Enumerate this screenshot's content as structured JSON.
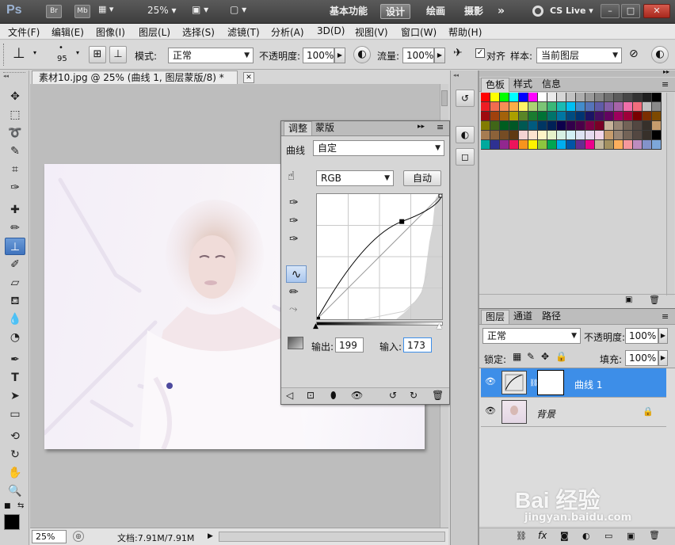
{
  "app": {
    "logo": "Ps",
    "bridge": "Br",
    "minibridge": "Mb",
    "zoom": "25%",
    "workspaces": [
      "基本功能",
      "设计",
      "绘画",
      "摄影"
    ],
    "active_workspace": "设计",
    "more": "»",
    "cslive": "CS Live",
    "window_controls": [
      "–",
      "□",
      "✕"
    ]
  },
  "menubar": {
    "items": [
      "文件(F)",
      "编辑(E)",
      "图像(I)",
      "图层(L)",
      "选择(S)",
      "滤镜(T)",
      "分析(A)",
      "3D(D)",
      "视图(V)",
      "窗口(W)",
      "帮助(H)"
    ]
  },
  "options": {
    "brush_size": "95",
    "mode_label": "模式:",
    "mode_value": "正常",
    "opacity_label": "不透明度:",
    "opacity_value": "100%",
    "flow_label": "流量:",
    "flow_value": "100%",
    "aligned_label": "对齐",
    "sample_label": "样本:",
    "sample_value": "当前图层"
  },
  "document": {
    "tab_title": "素材10.jpg @ 25% (曲线 1, 图层蒙版/8) *",
    "close": "✕"
  },
  "statusbar": {
    "zoom": "25%",
    "doc_info": "文档:7.91M/7.91M"
  },
  "curves_panel": {
    "tabs": [
      "调整",
      "蒙版"
    ],
    "preset_label": "曲线",
    "preset_value": "自定",
    "channel_value": "RGB",
    "auto_label": "自动",
    "output_label": "输出:",
    "output_value": "199",
    "input_label": "输入:",
    "input_value": "173",
    "curve_point": {
      "input": 173,
      "output": 199
    }
  },
  "swatch_panel": {
    "tabs": [
      "色板",
      "样式",
      "信息"
    ]
  },
  "layers_panel": {
    "tabs": [
      "图层",
      "通道",
      "路径"
    ],
    "blend_mode": "正常",
    "opacity_label": "不透明度:",
    "opacity_value": "100%",
    "lock_label": "锁定:",
    "fill_label": "填充:",
    "fill_value": "100%",
    "layers": [
      {
        "name": "曲线 1",
        "selected": true
      },
      {
        "name": "背景",
        "selected": false
      }
    ]
  },
  "watermark": {
    "logo": "Bai  经验",
    "url": "jingyan.baidu.com"
  },
  "colors": {
    "accent": "#3d8ee8",
    "appbar": "#4a4a4a",
    "panel": "#d3d3d3"
  }
}
